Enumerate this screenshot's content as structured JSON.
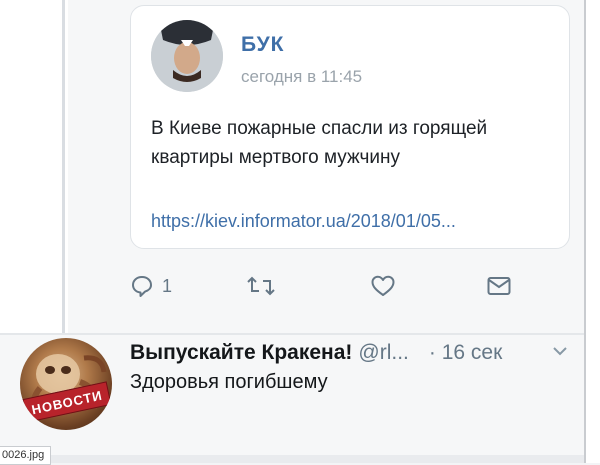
{
  "card": {
    "name": "БУК",
    "time": "сегодня в 11:45",
    "text": "В Киеве пожарные спасли из горящей квартиры мертвого мужчину",
    "link": "https://kiev.informator.ua/2018/01/05..."
  },
  "actions": {
    "reply_count": "1",
    "icons": [
      "reply-icon",
      "retweet-icon",
      "like-icon",
      "share-icon"
    ]
  },
  "reply": {
    "name": "Выпускайте Кракена!",
    "handle": "@rl...",
    "time": "· 16 сек",
    "text": "Здоровья погибшему",
    "avatar_banner": "НОВОСТИ"
  },
  "file_tag": "0026.jpg",
  "colors": {
    "link": "#3f6fa8",
    "muted": "#657786",
    "text": "#14171a",
    "banner": "#b8232b"
  }
}
